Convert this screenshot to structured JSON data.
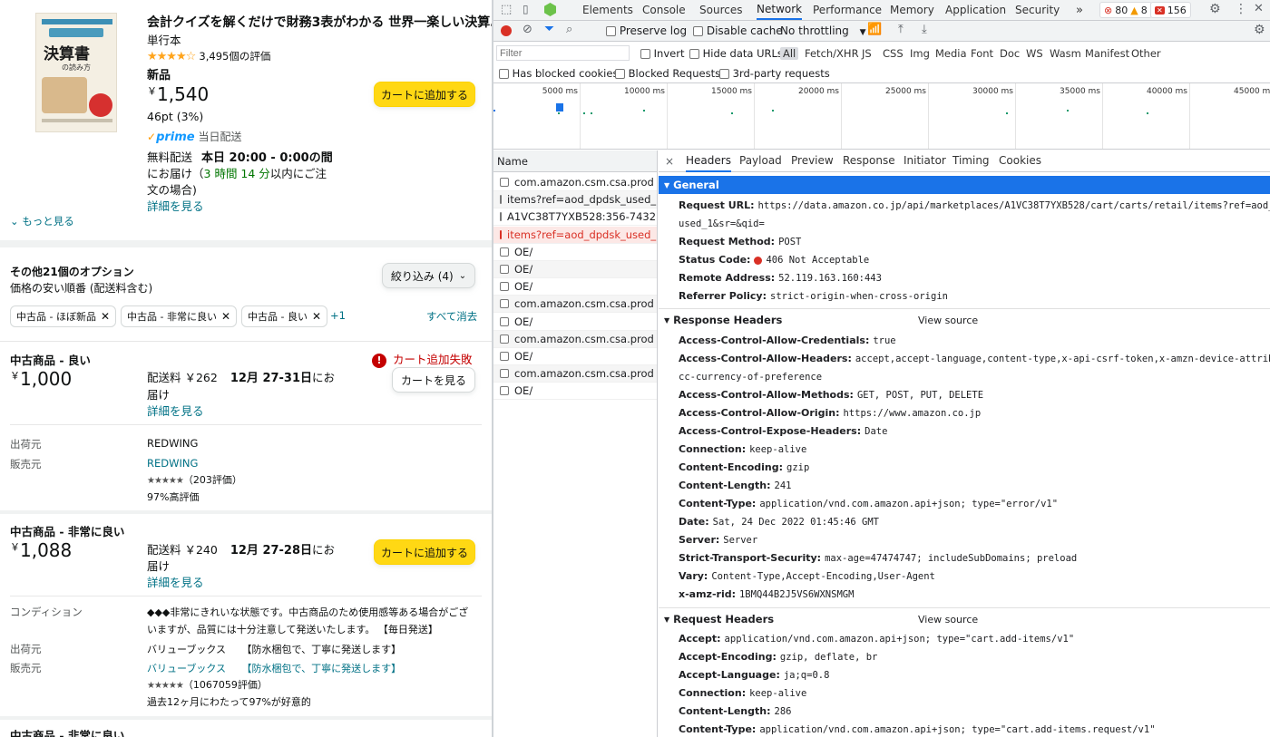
{
  "product": {
    "cover": {
      "title": "決算書",
      "subtitle": "の読み方"
    },
    "title": "会計クイズを解くだけで財務3表がわかる 世界一楽しい決算…",
    "binding": "単行本",
    "rating_stars": "★★★★☆",
    "rating_count": "3,495個の評価",
    "condition": "新品",
    "currency": "￥",
    "price": "1,540",
    "points": "46pt (3%)",
    "prime": "prime",
    "prime_delivery": "当日配送",
    "shipping_prefix": "無料配送",
    "shipping_time": "本日 20:00 - 0:00の間",
    "deliver_line1_a": "にお届け（",
    "deliver_countdown": "3 時間 14 分",
    "deliver_line1_b": "以内にご注",
    "deliver_line2": "文の場合)",
    "details_link": "詳細を見る",
    "add_to_cart": "カートに追加する",
    "see_more": "もっと見る"
  },
  "options": {
    "header": "その他21個のオプション",
    "sort": "価格の安い順番 (配送料含む)",
    "filter_button": "絞り込み (4)",
    "chips": [
      "中古品 - ほぼ新品",
      "中古品 - 非常に良い",
      "中古品 - 良い"
    ],
    "more_chips": "+1",
    "clear_all": "すべて消去"
  },
  "offer1": {
    "condition": "中古商品 - 良い",
    "currency": "￥",
    "price": "1,000",
    "shipping_fee": "配送料 ￥262",
    "delivery_date": "12月 27-31日",
    "delivery_suffix": "にお",
    "delivery_line2": "届け",
    "details_link": "詳細を見る",
    "error_text": "カート追加失敗",
    "view_cart": "カートを見る",
    "ships_from_label": "出荷元",
    "ships_from": "REDWING",
    "sold_by_label": "販売元",
    "sold_by": "REDWING",
    "seller_stars": "★★★★★",
    "seller_reviews": "（203評価）",
    "seller_positive": "97%高評価"
  },
  "offer2": {
    "condition": "中古商品 - 非常に良い",
    "currency": "￥",
    "price": "1,088",
    "shipping_fee": "配送料 ￥240",
    "delivery_date": "12月 27-28日",
    "delivery_suffix": "にお",
    "delivery_line2": "届け",
    "details_link": "詳細を見る",
    "add_to_cart": "カートに追加する",
    "condition_label": "コンディション",
    "condition_note_1": "◆◆◆非常にきれいな状態です。中古商品のため使用感等ある場合がござ",
    "condition_note_2": "いますが、品質には十分注意して発送いたします。 【毎日発送】",
    "ships_from_label": "出荷元",
    "ships_from": "バリューブックス",
    "ships_from_note": "【防水梱包で、丁寧に発送します】",
    "sold_by_label": "販売元",
    "sold_by": "バリューブックス",
    "sold_by_note": "【防水梱包で、丁寧に発送します】",
    "seller_stars": "★★★★★",
    "seller_reviews": "（1067059評価）",
    "seller_positive": "過去12ヶ月にわたって97%が好意的"
  },
  "offer3": {
    "condition": "中古商品 - 非常に良い"
  },
  "devtools": {
    "tabs": [
      "Elements",
      "Console",
      "Sources",
      "Network",
      "Performance",
      "Memory",
      "Application",
      "Security"
    ],
    "more_tabs": "»",
    "errors": "80",
    "warnings": "8",
    "issues": "156",
    "preserve_log": "Preserve log",
    "disable_cache": "Disable cache",
    "throttling": "No throttling",
    "filter_placeholder": "Filter",
    "invert": "Invert",
    "hide_data_urls": "Hide data URLs",
    "types": [
      "All",
      "Fetch/XHR",
      "JS",
      "CSS",
      "Img",
      "Media",
      "Font",
      "Doc",
      "WS",
      "Wasm",
      "Manifest",
      "Other"
    ],
    "has_blocked_cookies": "Has blocked cookies",
    "blocked_requests": "Blocked Requests",
    "third_party": "3rd-party requests",
    "timeline_labels": [
      "5000 ms",
      "10000 ms",
      "15000 ms",
      "20000 ms",
      "25000 ms",
      "30000 ms",
      "35000 ms",
      "40000 ms",
      "45000 ms"
    ],
    "name_header": "Name",
    "requests": [
      {
        "name": "com.amazon.csm.csa.prod",
        "error": false
      },
      {
        "name": "items?ref=aod_dpdsk_used_...",
        "error": false
      },
      {
        "name": "A1VC38T7YXB528:356-7432...",
        "error": false
      },
      {
        "name": "items?ref=aod_dpdsk_used_...",
        "error": true
      },
      {
        "name": "OE/",
        "error": false
      },
      {
        "name": "OE/",
        "error": false
      },
      {
        "name": "OE/",
        "error": false
      },
      {
        "name": "com.amazon.csm.csa.prod",
        "error": false
      },
      {
        "name": "OE/",
        "error": false
      },
      {
        "name": "com.amazon.csm.csa.prod",
        "error": false
      },
      {
        "name": "OE/",
        "error": false
      },
      {
        "name": "com.amazon.csm.csa.prod",
        "error": false
      },
      {
        "name": "OE/",
        "error": false
      }
    ],
    "detail_tabs": [
      "Headers",
      "Payload",
      "Preview",
      "Response",
      "Initiator",
      "Timing",
      "Cookies"
    ],
    "close": "×",
    "general_title": "General",
    "general": {
      "url_label": "Request URL:",
      "url_1": "https://data.amazon.co.jp/api/marketplaces/A1VC38T7YXB528/cart/carts/retail/items?ref=aod_dpdsk_",
      "url_2": "used_1&sr=&qid=",
      "method_label": "Request Method:",
      "method": "POST",
      "status_label": "Status Code:",
      "status": "406 Not Acceptable",
      "remote_label": "Remote Address:",
      "remote": "52.119.163.160:443",
      "referrer_label": "Referrer Policy:",
      "referrer": "strict-origin-when-cross-origin"
    },
    "response_title": "Response Headers",
    "request_title": "Request Headers",
    "view_source": "View source",
    "response_headers": [
      {
        "k": "Access-Control-Allow-Credentials:",
        "v": "true"
      },
      {
        "k": "Access-Control-Allow-Headers:",
        "v": "accept,accept-language,content-type,x-api-csrf-token,x-amzn-device-attributes,x-"
      },
      {
        "k": "",
        "v": "cc-currency-of-preference"
      },
      {
        "k": "Access-Control-Allow-Methods:",
        "v": "GET, POST, PUT, DELETE"
      },
      {
        "k": "Access-Control-Allow-Origin:",
        "v": "https://www.amazon.co.jp"
      },
      {
        "k": "Access-Control-Expose-Headers:",
        "v": "Date"
      },
      {
        "k": "Connection:",
        "v": "keep-alive"
      },
      {
        "k": "Content-Encoding:",
        "v": "gzip"
      },
      {
        "k": "Content-Length:",
        "v": "241"
      },
      {
        "k": "Content-Type:",
        "v": "application/vnd.com.amazon.api+json; type=\"error/v1\""
      },
      {
        "k": "Date:",
        "v": "Sat, 24 Dec 2022 01:45:46 GMT"
      },
      {
        "k": "Server:",
        "v": "Server"
      },
      {
        "k": "Strict-Transport-Security:",
        "v": "max-age=47474747; includeSubDomains; preload"
      },
      {
        "k": "Vary:",
        "v": "Content-Type,Accept-Encoding,User-Agent"
      },
      {
        "k": "x-amz-rid:",
        "v": "1BMQ44B2J5VS6WXNSMGM"
      }
    ],
    "request_headers": [
      {
        "k": "Accept:",
        "v": "application/vnd.com.amazon.api+json; type=\"cart.add-items/v1\""
      },
      {
        "k": "Accept-Encoding:",
        "v": "gzip, deflate, br"
      },
      {
        "k": "Accept-Language:",
        "v": "ja;q=0.8"
      },
      {
        "k": "Connection:",
        "v": "keep-alive"
      },
      {
        "k": "Content-Length:",
        "v": "286"
      },
      {
        "k": "Content-Type:",
        "v": "application/vnd.com.amazon.api+json; type=\"cart.add-items.request/v1\""
      }
    ]
  },
  "colors": {
    "accent": "#1a73e8",
    "error": "#d93025",
    "amazon_link": "#007185",
    "cart_yellow": "#ffd814",
    "prime_blue": "#1399ff"
  }
}
